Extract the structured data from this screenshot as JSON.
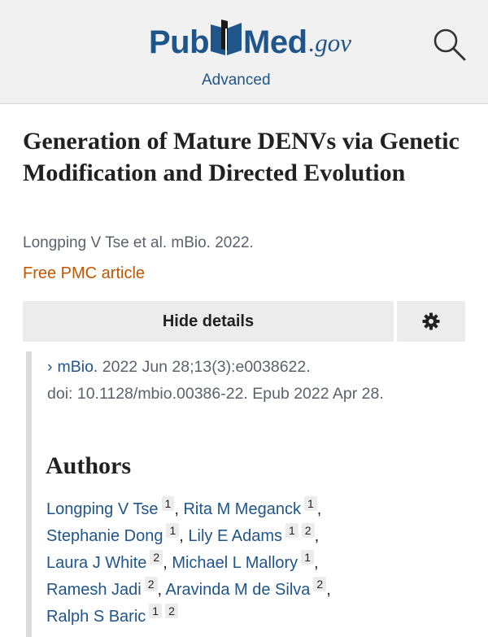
{
  "header": {
    "logo_pub": "Pub",
    "logo_med": "Med",
    "logo_gov": ".gov",
    "advanced": "Advanced"
  },
  "article": {
    "title": "Generation of Mature DENVs via Genetic Modification and Directed Evolution",
    "citation": "Longping V Tse et al. mBio. 2022.",
    "free_pmc": "Free PMC article"
  },
  "details": {
    "hide_label": "Hide details",
    "journal": "mBio.",
    "journal_rest": " 2022 Jun 28;13(3):e0038622.",
    "doi_line": "doi: 10.1128/mbio.00386-22. Epub 2022 Apr 28."
  },
  "authors": {
    "heading": "Authors",
    "rows": [
      [
        {
          "name": "Longping V Tse",
          "aff": [
            "1"
          ]
        },
        {
          "name": "Rita M Meganck",
          "aff": [
            "1"
          ]
        }
      ],
      [
        {
          "name": "Stephanie Dong",
          "aff": [
            "1"
          ]
        },
        {
          "name": "Lily E Adams",
          "aff": [
            "1",
            "2"
          ]
        }
      ],
      [
        {
          "name": "Laura J White",
          "aff": [
            "2"
          ]
        },
        {
          "name": "Michael L Mallory",
          "aff": [
            "1"
          ]
        }
      ],
      [
        {
          "name": "Ramesh Jadi",
          "aff": [
            "2"
          ]
        },
        {
          "name": "Aravinda M de Silva",
          "aff": [
            "2"
          ]
        }
      ],
      [
        {
          "name": "Ralph S Baric",
          "aff": [
            "1",
            "2"
          ]
        }
      ]
    ]
  },
  "colors": {
    "brand": "#20558a",
    "free_article": "#c05600",
    "header_bg": "#f1f1f1",
    "button_bg": "#ececec"
  },
  "icons": [
    "search-icon",
    "gear-icon",
    "chevron-right-icon",
    "pubmed-logo-icon"
  ]
}
